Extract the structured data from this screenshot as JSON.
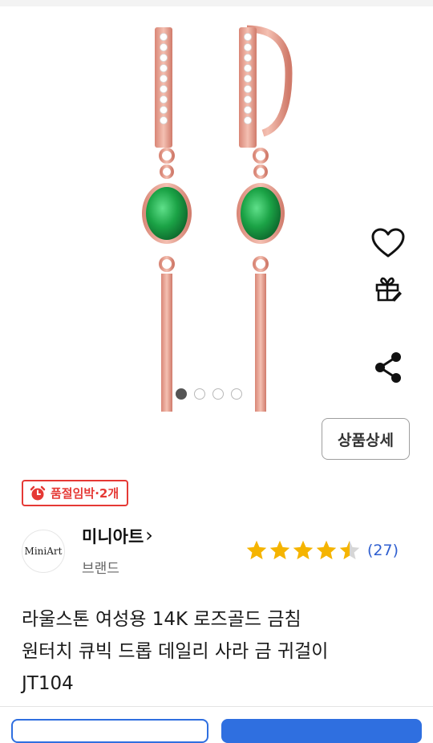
{
  "gallery": {
    "image_alt": "rose gold drop earrings with green oval stone",
    "dots_total": 4,
    "active_dot": 1
  },
  "side_actions": {
    "wishlist_icon": "heart-icon",
    "gift_icon": "gift-icon",
    "share_icon": "share-icon"
  },
  "detail_button": {
    "label": "상품상세"
  },
  "stock_badge": {
    "icon": "alarm-clock-icon",
    "text": "품절임박·2개",
    "color": "#e53935"
  },
  "brand": {
    "logo_text": "MiniArt",
    "name": "미니아트",
    "chevron": "›",
    "subtitle": "브랜드"
  },
  "rating": {
    "stars": 4.5,
    "max_stars": 5,
    "count": "(27)",
    "star_color": "#f5b400",
    "count_color": "#2f5fd0"
  },
  "product": {
    "title_line1": "라울스톤 여성용 14K 로즈골드 금침",
    "title_line2": "원터치 큐빅 드롭 데일리 사라 금 귀걸이",
    "title_line3": "JT104"
  },
  "colors": {
    "accent": "#2f6fe0",
    "rose_gold": "#e8a292",
    "emerald": "#1ea34a"
  }
}
